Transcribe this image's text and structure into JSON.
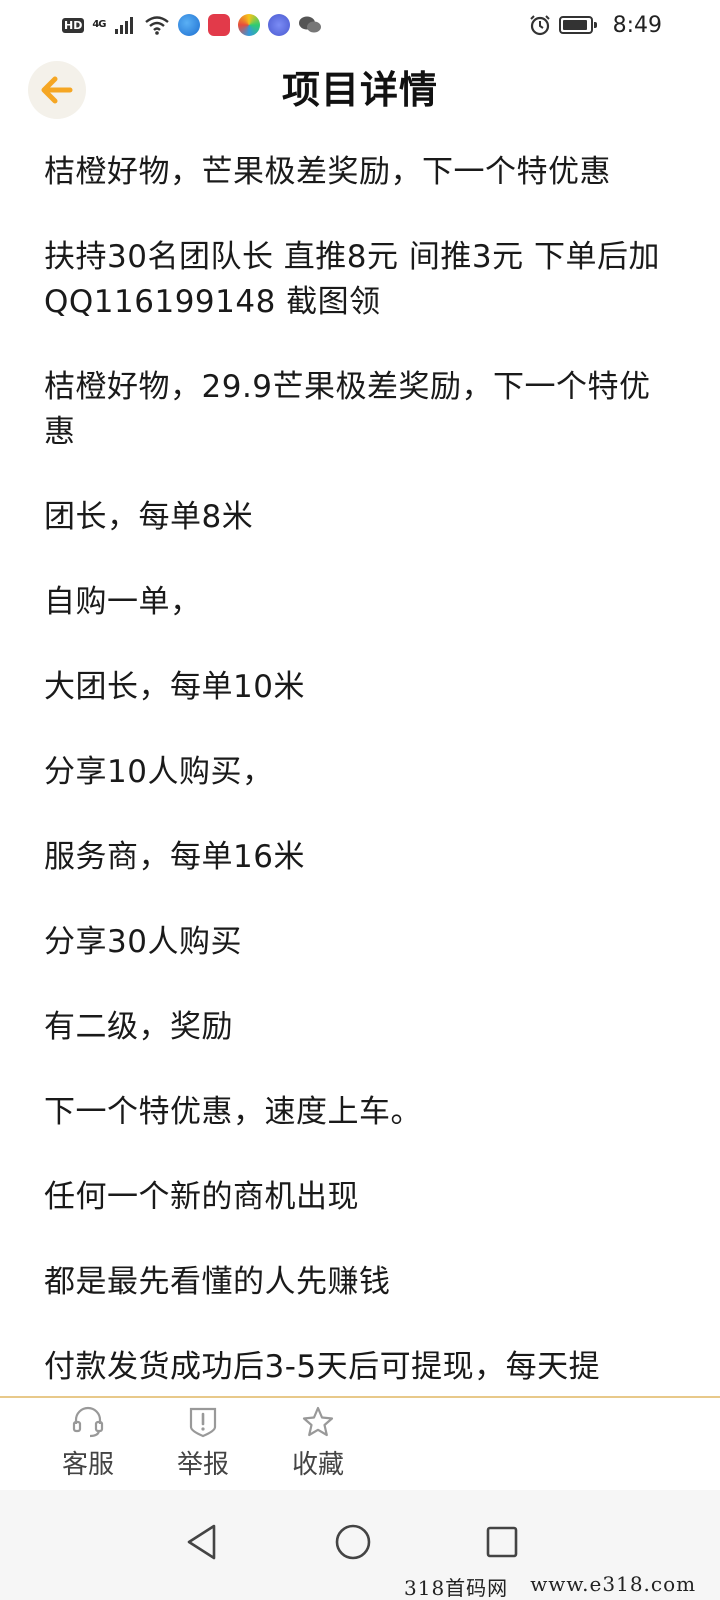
{
  "status_bar": {
    "hd": "HD",
    "network": "4G",
    "time": "8:49"
  },
  "header": {
    "title": "项目详情"
  },
  "content": {
    "paragraphs": [
      "桔橙好物，芒果极差奖励，下一个特优惠",
      "扶持30名团队长   直推8元  间推3元  下单后加QQ116199148 截图领",
      "桔橙好物，29.9芒果极差奖励，下一个特优惠",
      "团长，每单8米",
      "自购一单，",
      "大团长，每单10米",
      "分享10人购买，",
      "服务商，每单16米",
      "分享30人购买",
      "有二级，奖励",
      "下一个特优惠，速度上车。",
      "任何一个新的商机出现",
      "都是最先看懂的人先赚钱",
      "付款发货成功后3-5天后可提现，每天提"
    ]
  },
  "action_bar": {
    "service_label": "客服",
    "report_label": "举报",
    "favorite_label": "收藏"
  },
  "watermark": {
    "site_name": "318首码网",
    "site_url": "www.e318.com"
  },
  "colors": {
    "accent": "#f5a623",
    "divider": "#e8c98a"
  }
}
